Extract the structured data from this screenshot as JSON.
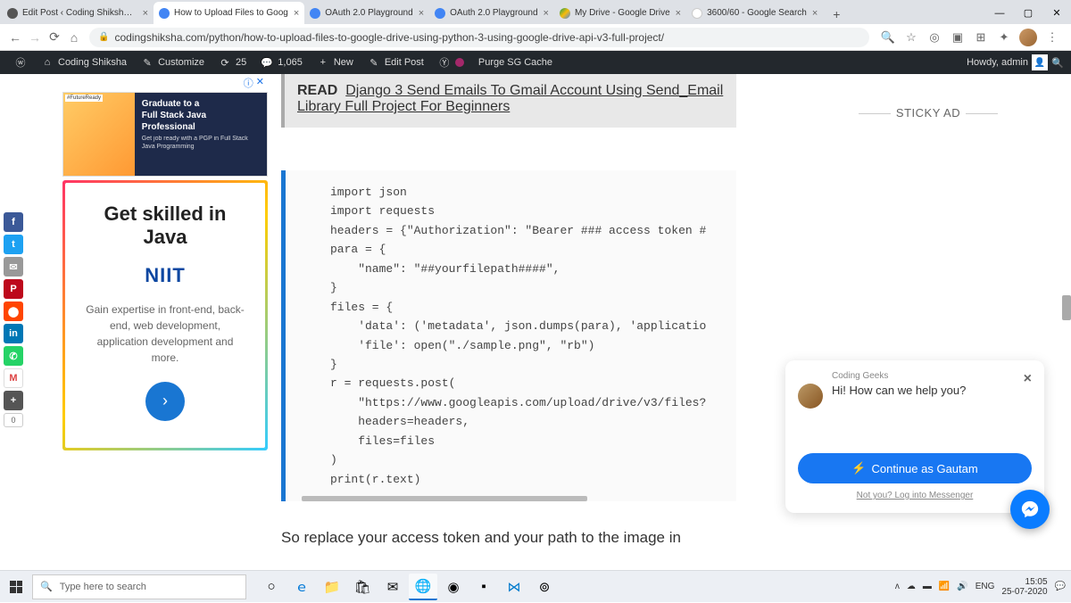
{
  "tabs": [
    {
      "label": "Edit Post ‹ Coding Shiksha —"
    },
    {
      "label": "How to Upload Files to Goog"
    },
    {
      "label": "OAuth 2.0 Playground"
    },
    {
      "label": "OAuth 2.0 Playground"
    },
    {
      "label": "My Drive - Google Drive"
    },
    {
      "label": "3600/60 - Google Search"
    }
  ],
  "url": "codingshiksha.com/python/how-to-upload-files-to-google-drive-using-python-3-using-google-drive-api-v3-full-project/",
  "wp": {
    "site": "Coding Shiksha",
    "customize": "Customize",
    "updates": "25",
    "comments": "1,065",
    "new": "New",
    "edit": "Edit Post",
    "purge": "Purge SG Cache",
    "howdy": "Howdy, admin"
  },
  "social_count": "0",
  "ad": {
    "head_title": "Graduate to a\nFull Stack Java\nProfessional",
    "head_sub": "Get job ready with a PGP in Full Stack Java Programming",
    "card_title": "Get skilled in Java",
    "logo": "NIIT",
    "desc": "Gain expertise in front-end, back-end, web development, application development and more.",
    "arrow": "›"
  },
  "read": {
    "tag": "READ",
    "link": "Django 3 Send Emails To Gmail Account Using Send_Email Library Full Project For Beginners"
  },
  "code": "import json\nimport requests\nheaders = {\"Authorization\": \"Bearer ### access token #\npara = {\n    \"name\": \"##yourfilepath####\",\n}\nfiles = {\n    'data': ('metadata', json.dumps(para), 'applicatio\n    'file': open(\"./sample.png\", \"rb\")\n}\nr = requests.post(\n    \"https://www.googleapis.com/upload/drive/v3/files?\n    headers=headers,\n    files=files\n)\nprint(r.text)",
  "body_text": "So replace your access token and your path to the image in",
  "sticky": "STICKY AD",
  "chat": {
    "name": "Coding Geeks",
    "msg": "Hi! How can we help you?",
    "btn": "Continue as Gautam",
    "link": "Not you? Log into Messenger"
  },
  "search_placeholder": "Type here to search",
  "tray": {
    "lang": "ENG",
    "time": "15:05",
    "date": "25-07-2020"
  }
}
